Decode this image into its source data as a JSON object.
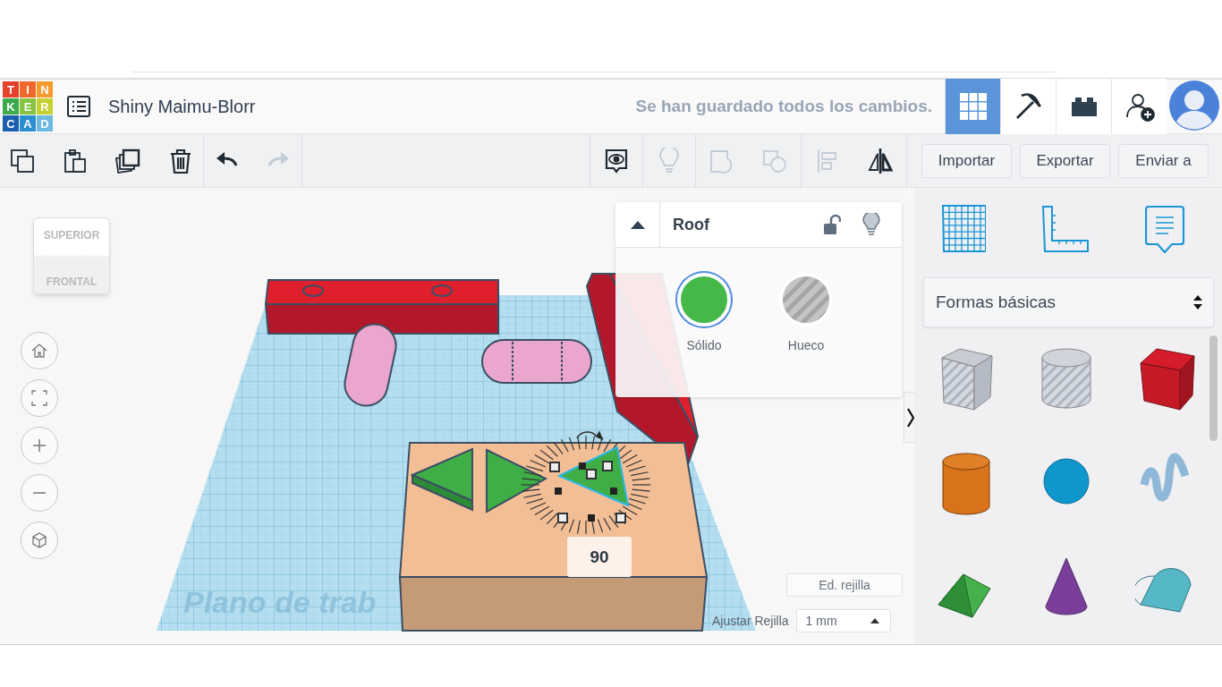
{
  "header": {
    "logo": [
      {
        "letter": "T",
        "color": "#e3422b"
      },
      {
        "letter": "I",
        "color": "#f2682a"
      },
      {
        "letter": "N",
        "color": "#f79a2c"
      },
      {
        "letter": "K",
        "color": "#3ca94b"
      },
      {
        "letter": "E",
        "color": "#84c441"
      },
      {
        "letter": "R",
        "color": "#c3d230"
      },
      {
        "letter": "C",
        "color": "#1c5fae"
      },
      {
        "letter": "A",
        "color": "#2a8fd0"
      },
      {
        "letter": "D",
        "color": "#6db9e1"
      }
    ],
    "project_name": "Shiny Maimu-Blorr",
    "save_status": "Se han guardado todos los cambios.",
    "views": [
      {
        "kind": "grid",
        "selected": true
      },
      {
        "kind": "pickaxe",
        "selected": false
      },
      {
        "kind": "bricks",
        "selected": false
      }
    ]
  },
  "toolbar": {
    "left_groups": [
      [
        {
          "kind": "copy",
          "disabled": false
        },
        {
          "kind": "paste",
          "disabled": false
        },
        {
          "kind": "duplicate",
          "disabled": false
        },
        {
          "kind": "delete",
          "disabled": false
        }
      ],
      [
        {
          "kind": "undo",
          "disabled": false
        },
        {
          "kind": "redo",
          "disabled": true
        }
      ]
    ],
    "right_groups": [
      [
        {
          "kind": "notes",
          "disabled": false
        }
      ],
      [
        {
          "kind": "bulb",
          "disabled": true
        }
      ],
      [
        {
          "kind": "group",
          "disabled": true
        },
        {
          "kind": "ungroup",
          "disabled": true
        }
      ],
      [
        {
          "kind": "align",
          "disabled": true
        },
        {
          "kind": "mirror",
          "disabled": false
        }
      ]
    ],
    "buttons": [
      "Importar",
      "Exportar",
      "Enviar a"
    ]
  },
  "viewcube": {
    "top": "SUPERIOR",
    "front": "FRONTAL"
  },
  "workplane": {
    "label": "Plano de trab",
    "rotation_reading": "90"
  },
  "inspector": {
    "expanded": true,
    "title": "Roof",
    "locked": false,
    "options": [
      {
        "kind": "solid",
        "label": "Sólido",
        "selected": true
      },
      {
        "kind": "hole",
        "label": "Hueco",
        "selected": false
      }
    ]
  },
  "grid_controls": {
    "edit_button": "Ed. rejilla",
    "snap_label": "Ajustar Rejilla",
    "snap_value": "1 mm"
  },
  "library": {
    "category": "Formas básicas",
    "shapes": [
      {
        "kind": "box-hole"
      },
      {
        "kind": "cylinder-hole"
      },
      {
        "kind": "box"
      },
      {
        "kind": "cylinder"
      },
      {
        "kind": "sphere"
      },
      {
        "kind": "scribble"
      },
      {
        "kind": "roof"
      },
      {
        "kind": "cone"
      },
      {
        "kind": "round-roof"
      }
    ]
  }
}
